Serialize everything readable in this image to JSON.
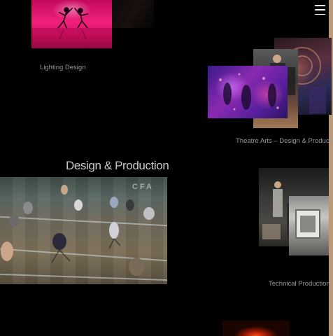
{
  "header": {
    "menu_icon": "hamburger-menu-icon"
  },
  "sections": {
    "lighting_label": "Lighting Design",
    "theatre_label": "Theatre Arts – Design & Production",
    "design_heading": "Design & Production",
    "technical_label": "Technical Production"
  },
  "design_image": {
    "overlay_text": "CFA"
  },
  "colors": {
    "background": "#000000",
    "label_text": "#9a9a9a",
    "heading_text": "#c8c8c8",
    "right_strip": "#b89a78"
  }
}
